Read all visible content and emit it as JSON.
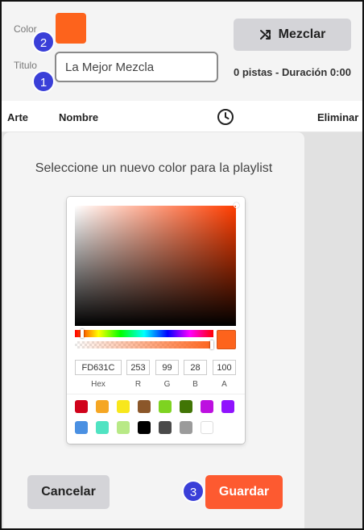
{
  "header": {
    "color_label": "Color",
    "title_label": "Titulo",
    "title_value": "La Mejor Mezcla",
    "shuffle_label": "Mezclar",
    "stats": "0 pistas - Duración 0:00",
    "swatch_color": "#fd631c",
    "shuffle_icon": "shuffle-icon"
  },
  "badges": [
    "1",
    "2",
    "3"
  ],
  "table": {
    "columns": {
      "art": "Arte",
      "name": "Nombre",
      "duration_icon": "clock-icon",
      "delete": "Eliminar"
    }
  },
  "modal": {
    "title": "Seleccione un nuevo color para la playlist",
    "picker": {
      "hex": "FD631C",
      "r": "253",
      "g": "99",
      "b": "28",
      "a": "100",
      "labels": {
        "hex": "Hex",
        "r": "R",
        "g": "G",
        "b": "B",
        "a": "A"
      },
      "hue_level": 0.04,
      "alpha_level": 1.0,
      "presets": [
        "#d0021b",
        "#f5a623",
        "#f8e71c",
        "#8b572a",
        "#7ed321",
        "#417505",
        "#bd10e0",
        "#9013fe",
        "#4a90e2",
        "#50e3c2",
        "#b8e986",
        "#000000",
        "#4a4a4a",
        "#9b9b9b",
        "#ffffff"
      ]
    },
    "cancel_label": "Cancelar",
    "save_label": "Guardar"
  },
  "colors": {
    "accent": "#fd5a30",
    "badge": "#3a3fd8",
    "selected": "#fd631c"
  }
}
